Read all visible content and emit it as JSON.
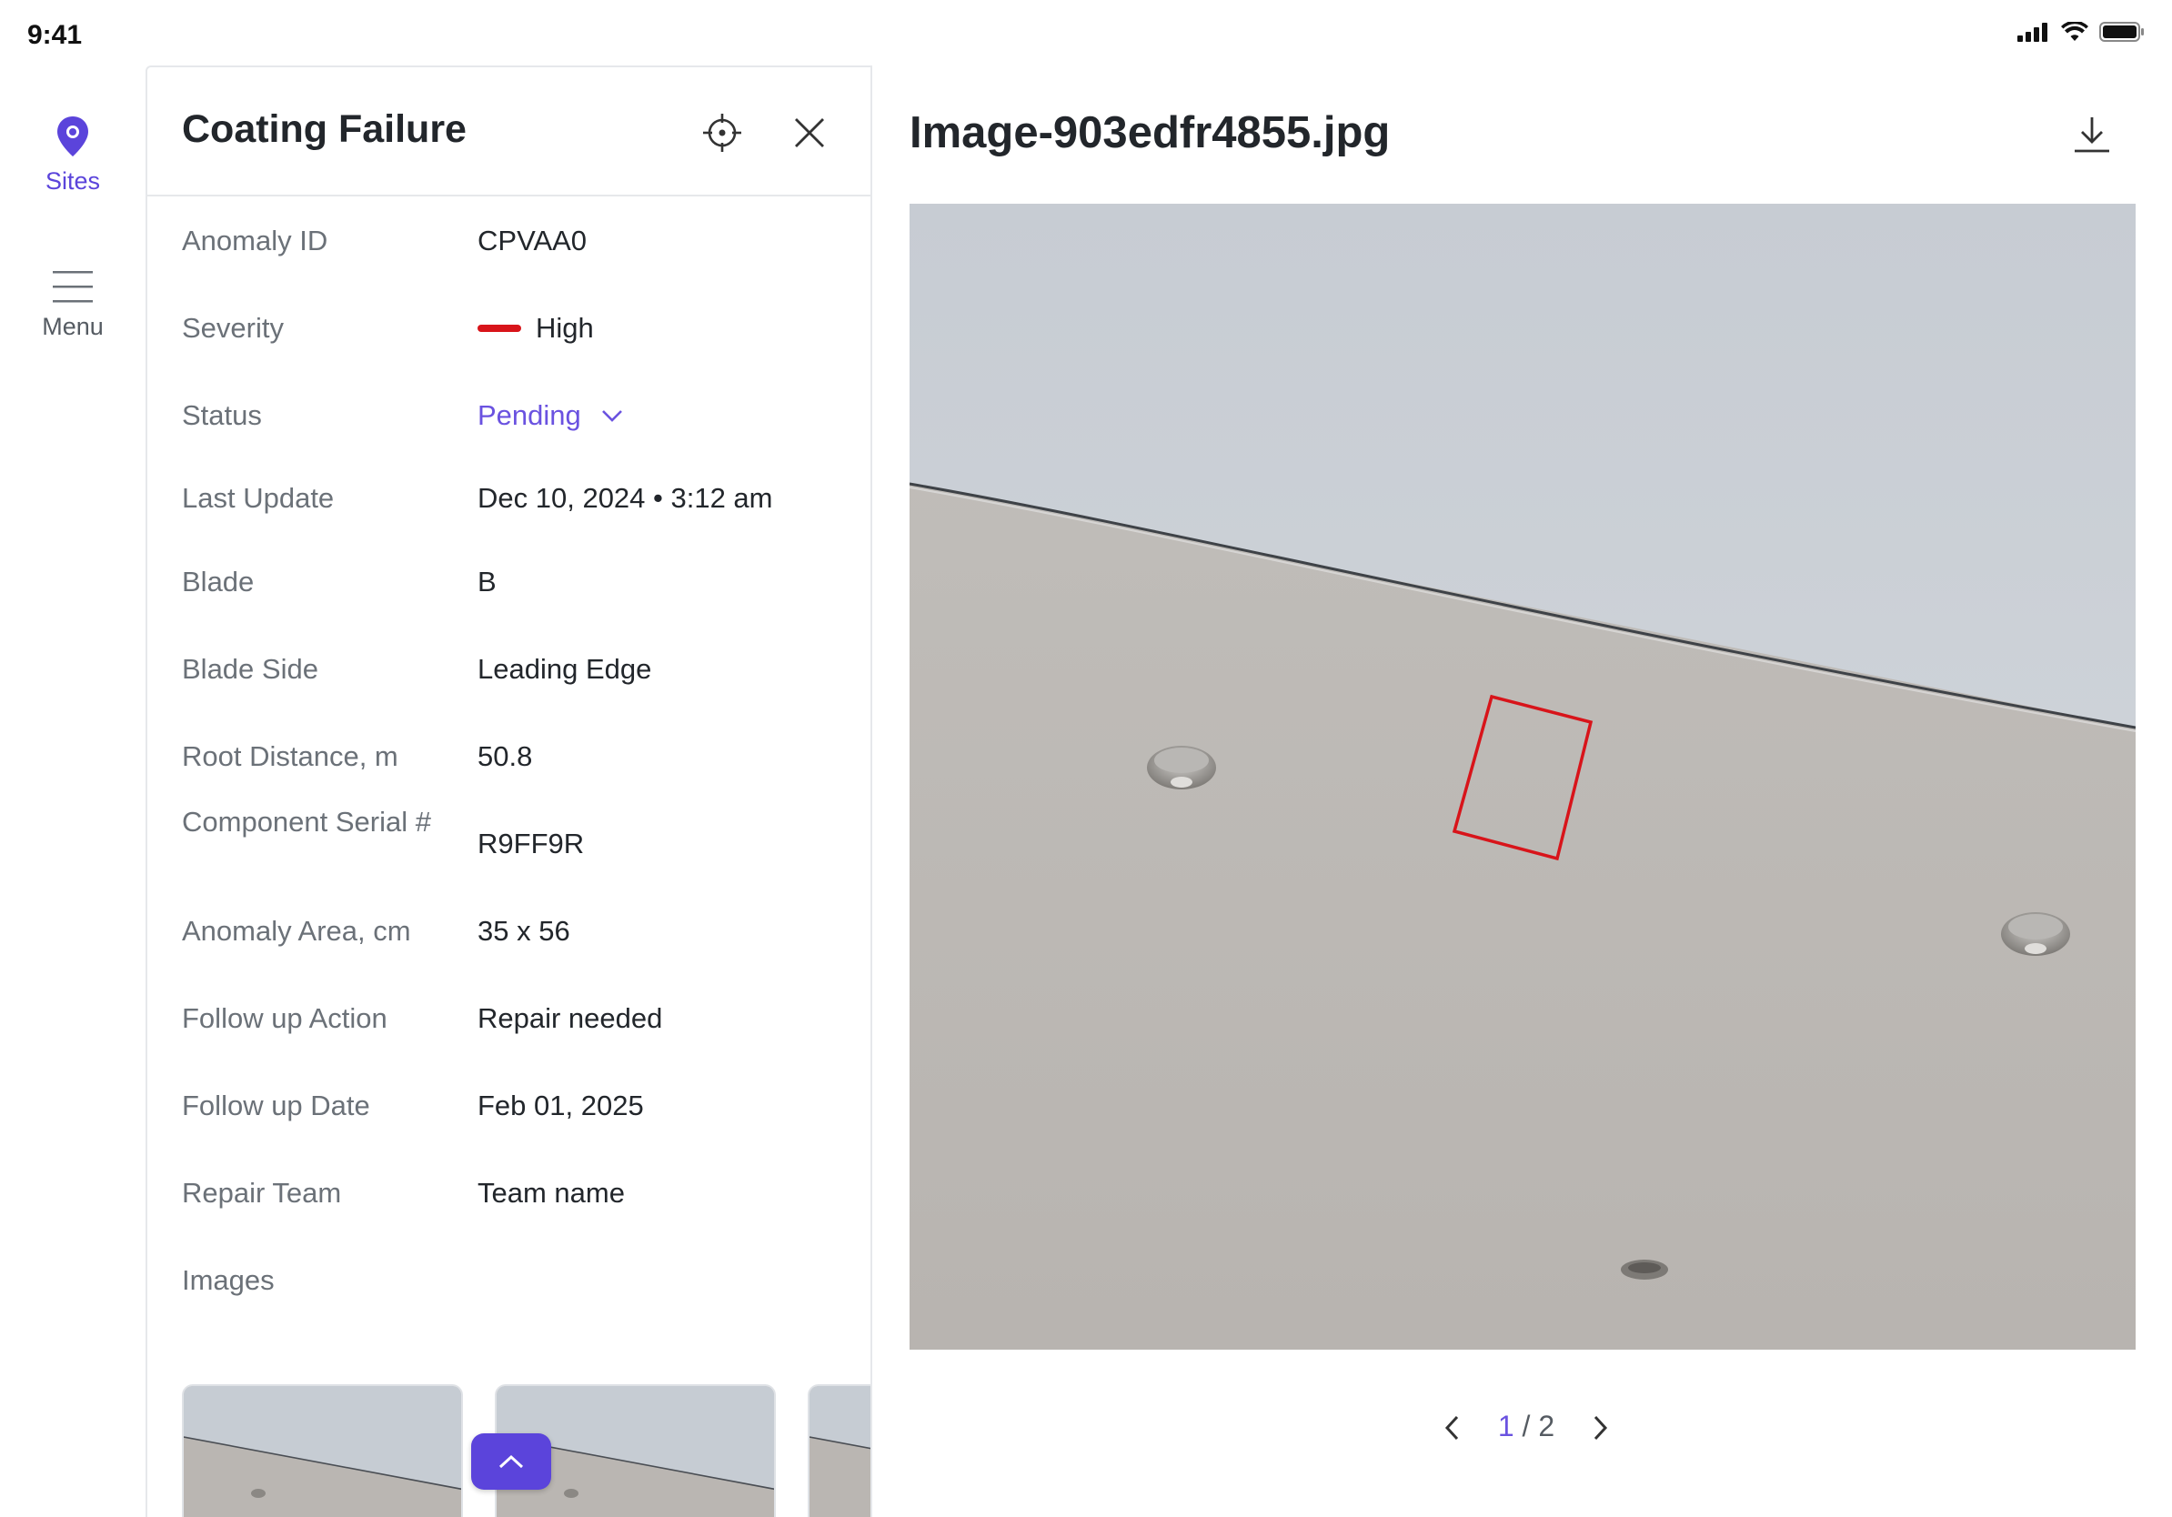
{
  "status_bar": {
    "time": "9:41"
  },
  "rail": {
    "items": [
      {
        "label": "Sites",
        "icon": "map-pin-icon",
        "active": true
      },
      {
        "label": "Menu",
        "icon": "hamburger-menu-icon",
        "active": false
      }
    ],
    "active_color": "#5b44db",
    "inactive_color": "#6b7178"
  },
  "panel": {
    "title": "Coating Failure",
    "fields": [
      {
        "label": "Anomaly ID",
        "value": "CPVAA0"
      },
      {
        "label": "Severity",
        "value": "High",
        "indicator_color": "#d8141a"
      },
      {
        "label": "Status",
        "value": "Pending"
      },
      {
        "label": "Last Update",
        "value": "Dec 10, 2024 • 3:12 am"
      },
      {
        "label": "Blade",
        "value": "B"
      },
      {
        "label": "Blade Side",
        "value": "Leading Edge"
      },
      {
        "label": "Root Distance, m",
        "value": "50.8"
      },
      {
        "label": "Component Serial #",
        "value": "R9FF9R"
      },
      {
        "label": "Anomaly Area, cm",
        "value": "35 x 56"
      },
      {
        "label": "Follow up Action",
        "value": "Repair needed"
      },
      {
        "label": "Follow up Date",
        "value": "Feb 01, 2025"
      },
      {
        "label": "Repair Team",
        "value": "Team name"
      }
    ],
    "images_label": "Images"
  },
  "viewer": {
    "filename": "Image-903edfr4855.jpg",
    "page_current": "1",
    "page_separator": "/",
    "page_total": "2",
    "marker_color": "#d8141a"
  }
}
